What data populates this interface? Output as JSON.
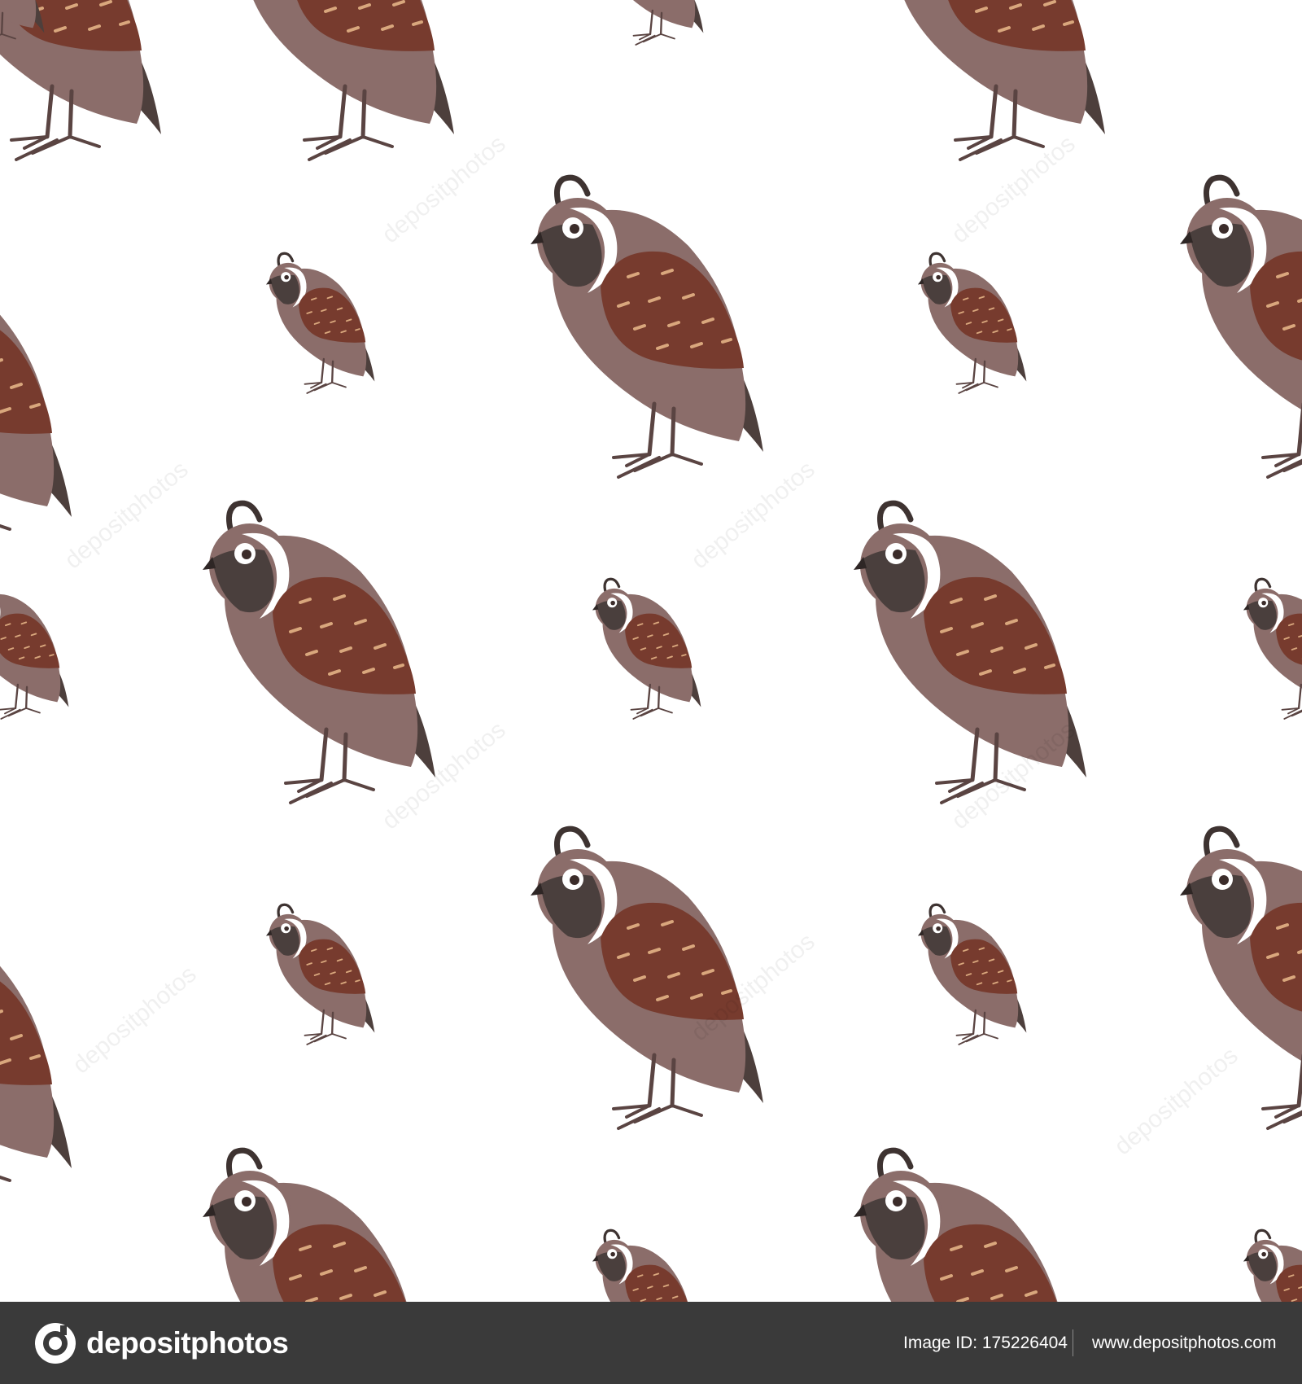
{
  "colors": {
    "background": "#ffffff",
    "body": "#8b6d6a",
    "wing": "#773b2e",
    "face": "#4a3f3d",
    "head": "#8b6d6a",
    "feather_marks": "#d9a77d",
    "tail": "#4d3f3c",
    "legs": "#5a4442",
    "footer": "#3a3a3a",
    "footer_text": "#ffffff"
  },
  "illustration": {
    "subject": "quail",
    "icon": "quail-icon",
    "watermark_icon": "camera-icon"
  },
  "watermark": {
    "text": "depositphotos"
  },
  "footer": {
    "brand": "depositphotos",
    "image_id_label": "Image ID:",
    "image_id": "175226404",
    "image_id_text": "Image ID: 175226404",
    "url": "www.depositphotos.com"
  }
}
